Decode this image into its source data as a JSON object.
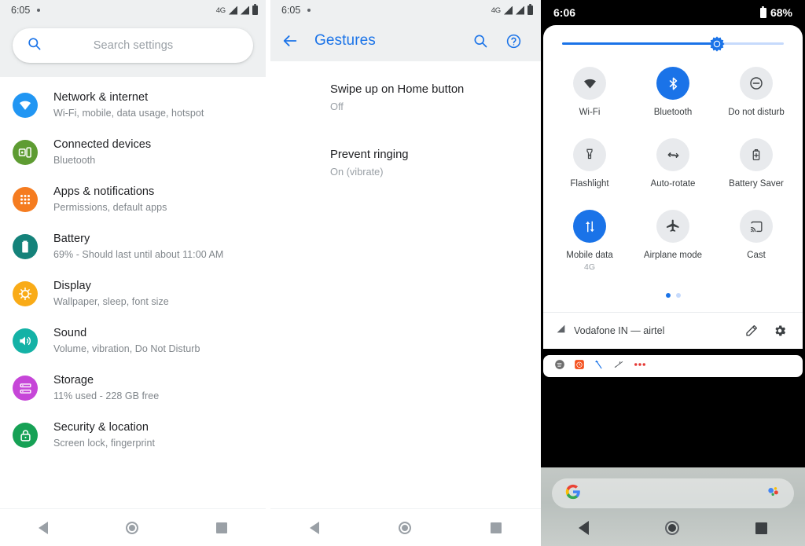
{
  "panel_settings": {
    "name": "android-settings-home",
    "statusbar": {
      "time": "6:05",
      "network": "4G",
      "dot": "•"
    },
    "search": {
      "placeholder": "Search settings",
      "icon": "search-icon"
    },
    "items": [
      {
        "title": "Network & internet",
        "subtitle": "Wi-Fi, mobile, data usage, hotspot",
        "icon": "wifi-icon",
        "color": "#2196f3"
      },
      {
        "title": "Connected devices",
        "subtitle": "Bluetooth",
        "icon": "cast-devices-icon",
        "color": "#5e9c32"
      },
      {
        "title": "Apps & notifications",
        "subtitle": "Permissions, default apps",
        "icon": "apps-grid-icon",
        "color": "#f57c20"
      },
      {
        "title": "Battery",
        "subtitle": "69% - Should last until about 11:00 AM",
        "icon": "battery-icon",
        "color": "#14827a"
      },
      {
        "title": "Display",
        "subtitle": "Wallpaper, sleep, font size",
        "icon": "brightness-icon",
        "color": "#f9ab17"
      },
      {
        "title": "Sound",
        "subtitle": "Volume, vibration, Do Not Disturb",
        "icon": "volume-icon",
        "color": "#14b2a6"
      },
      {
        "title": "Storage",
        "subtitle": "11% used - 228 GB free",
        "icon": "storage-icon",
        "color": "#c646d8"
      },
      {
        "title": "Security & location",
        "subtitle": "Screen lock, fingerprint",
        "icon": "lock-icon",
        "color": "#16a155"
      }
    ],
    "navbar": {
      "back": "back-icon",
      "home": "home-icon",
      "recents": "recents-icon"
    }
  },
  "panel_gestures": {
    "name": "android-gestures-screen",
    "statusbar": {
      "time": "6:05",
      "network": "4G",
      "dot": "•"
    },
    "appbar": {
      "title": "Gestures",
      "back_icon": "arrow-back-icon",
      "search_icon": "search-icon",
      "help_icon": "help-circle-icon",
      "accent": "#1a73e8"
    },
    "items": [
      {
        "title": "Swipe up on Home button",
        "subtitle": "Off"
      },
      {
        "title": "Prevent ringing",
        "subtitle": "On (vibrate)"
      }
    ],
    "navbar": {
      "back": "back-icon",
      "home": "home-icon",
      "recents": "recents-icon"
    }
  },
  "panel_quicksettings": {
    "name": "android-quick-settings",
    "statusbar": {
      "time": "6:06",
      "battery": "68%"
    },
    "brightness": {
      "value_percent": 70,
      "icon": "brightness-slider-icon"
    },
    "tiles": [
      {
        "label": "Wi-Fi",
        "sub": "",
        "icon": "wifi-icon",
        "state": "off"
      },
      {
        "label": "Bluetooth",
        "sub": "",
        "icon": "bluetooth-icon",
        "state": "on"
      },
      {
        "label": "Do not disturb",
        "sub": "",
        "icon": "do-not-disturb-icon",
        "state": "off"
      },
      {
        "label": "Flashlight",
        "sub": "",
        "icon": "flashlight-icon",
        "state": "off"
      },
      {
        "label": "Auto-rotate",
        "sub": "",
        "icon": "auto-rotate-icon",
        "state": "off"
      },
      {
        "label": "Battery Saver",
        "sub": "",
        "icon": "battery-saver-icon",
        "state": "off"
      },
      {
        "label": "Mobile data",
        "sub": "4G",
        "icon": "mobile-data-icon",
        "state": "on"
      },
      {
        "label": "Airplane mode",
        "sub": "",
        "icon": "airplane-icon",
        "state": "off"
      },
      {
        "label": "Cast",
        "sub": "",
        "icon": "cast-icon",
        "state": "off"
      }
    ],
    "pager": {
      "pages": 2,
      "active": 1
    },
    "footer": {
      "carrier": "Vodafone IN — airtel",
      "signal_icon": "signal-icon",
      "edit_icon": "pencil-edit-icon",
      "settings_icon": "gear-icon"
    },
    "notification_icons": [
      "spotify-icon",
      "alarm-icon",
      "pen-icon",
      "flight-icon",
      "more-icon"
    ],
    "home": {
      "google_icon": "google-g-icon",
      "assistant_icon": "assistant-icon"
    },
    "navbar": {
      "back": "back-icon",
      "home": "home-icon",
      "recents": "recents-icon"
    },
    "accent": "#1a73e8"
  }
}
